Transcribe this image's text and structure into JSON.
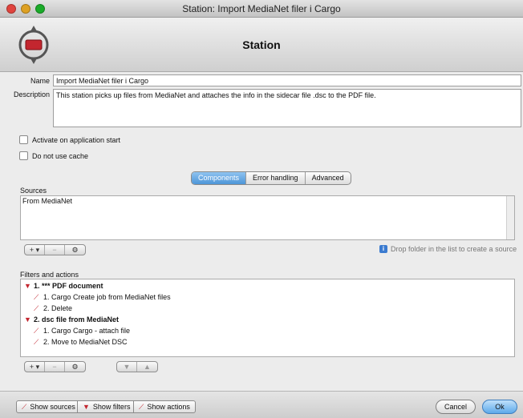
{
  "window": {
    "title": "Station: Import MediaNet filer i Cargo"
  },
  "header": {
    "title": "Station"
  },
  "form": {
    "name_label": "Name",
    "name_value": "Import MediaNet filer i Cargo",
    "description_label": "Description",
    "description_value": "This station picks up files from MediaNet and attaches the info in the sidecar file .dsc to the PDF file.",
    "activate_label": "Activate on application start",
    "nocache_label": "Do not use cache"
  },
  "tabs": [
    {
      "label": "Components",
      "active": true
    },
    {
      "label": "Error handling",
      "active": false
    },
    {
      "label": "Advanced",
      "active": false
    }
  ],
  "sources": {
    "label": "Sources",
    "items": [
      "From MediaNet"
    ],
    "add_label": "+ ▾",
    "remove_label": "−",
    "gear_label": "⚙",
    "hint": "Drop folder in the list to create a source"
  },
  "filters": {
    "label": "Filters and actions",
    "tree": [
      {
        "text": "1. *** PDF document",
        "level": 0,
        "kind": "filter"
      },
      {
        "text": "1. Cargo Create job from MediaNet files",
        "level": 1,
        "kind": "action"
      },
      {
        "text": "2. Delete",
        "level": 1,
        "kind": "action"
      },
      {
        "text": "2. dsc file from MediaNet",
        "level": 0,
        "kind": "filter"
      },
      {
        "text": "1. Cargo Cargo - attach file",
        "level": 1,
        "kind": "action"
      },
      {
        "text": "2. Move to MediaNet DSC",
        "level": 1,
        "kind": "action"
      }
    ],
    "add_label": "+ ▾",
    "remove_label": "−",
    "gear_label": "⚙",
    "down_label": "▼",
    "up_label": "▲"
  },
  "footer": {
    "show_sources": "Show sources",
    "show_filters": "Show filters",
    "show_actions": "Show actions",
    "cancel": "Cancel",
    "ok": "Ok"
  },
  "colors": {
    "accent": "#4d95d8",
    "icon_red": "#c3262f"
  }
}
